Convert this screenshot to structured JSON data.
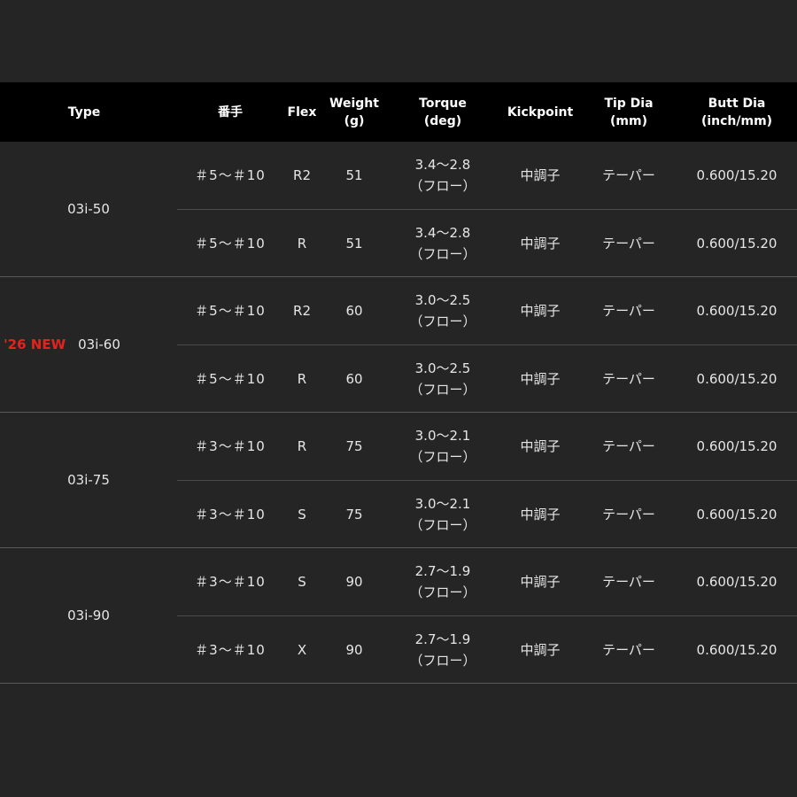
{
  "header": {
    "type": "Type",
    "number": "番手",
    "flex": "Flex",
    "weight_l1": "Weight",
    "weight_l2": "(g)",
    "torque_l1": "Torque",
    "torque_l2": "(deg)",
    "kickpoint": "Kickpoint",
    "tip_l1": "Tip Dia",
    "tip_l2": "(mm)",
    "butt_l1": "Butt Dia",
    "butt_l2": "(inch/mm)"
  },
  "groups": [
    {
      "type": "03i-50",
      "badge": "",
      "rows": [
        {
          "number": "＃5～＃10",
          "flex": "R2",
          "weight": "51",
          "torque": "3.4～2.8",
          "torque_note": "（フロー）",
          "kickpoint": "中調子",
          "tip": "テーパー",
          "butt": "0.600/15.20"
        },
        {
          "number": "＃5～＃10",
          "flex": "R",
          "weight": "51",
          "torque": "3.4～2.8",
          "torque_note": "（フロー）",
          "kickpoint": "中調子",
          "tip": "テーパー",
          "butt": "0.600/15.20"
        }
      ]
    },
    {
      "type": "03i-60",
      "badge": "'26 NEW",
      "rows": [
        {
          "number": "＃5～＃10",
          "flex": "R2",
          "weight": "60",
          "torque": "3.0～2.5",
          "torque_note": "（フロー）",
          "kickpoint": "中調子",
          "tip": "テーパー",
          "butt": "0.600/15.20"
        },
        {
          "number": "＃5～＃10",
          "flex": "R",
          "weight": "60",
          "torque": "3.0～2.5",
          "torque_note": "（フロー）",
          "kickpoint": "中調子",
          "tip": "テーパー",
          "butt": "0.600/15.20"
        }
      ]
    },
    {
      "type": "03i-75",
      "badge": "",
      "rows": [
        {
          "number": "＃3～＃10",
          "flex": "R",
          "weight": "75",
          "torque": "3.0～2.1",
          "torque_note": "（フロー）",
          "kickpoint": "中調子",
          "tip": "テーパー",
          "butt": "0.600/15.20"
        },
        {
          "number": "＃3～＃10",
          "flex": "S",
          "weight": "75",
          "torque": "3.0～2.1",
          "torque_note": "（フロー）",
          "kickpoint": "中調子",
          "tip": "テーパー",
          "butt": "0.600/15.20"
        }
      ]
    },
    {
      "type": "03i-90",
      "badge": "",
      "rows": [
        {
          "number": "＃3～＃10",
          "flex": "S",
          "weight": "90",
          "torque": "2.7～1.9",
          "torque_note": "（フロー）",
          "kickpoint": "中調子",
          "tip": "テーパー",
          "butt": "0.600/15.20"
        },
        {
          "number": "＃3～＃10",
          "flex": "X",
          "weight": "90",
          "torque": "2.7～1.9",
          "torque_note": "（フロー）",
          "kickpoint": "中調子",
          "tip": "テーパー",
          "butt": "0.600/15.20"
        }
      ]
    }
  ],
  "colors": {
    "background": "#252525",
    "header_bg": "#000000",
    "new_badge": "#e4231f",
    "divider": "#5a5a5a"
  }
}
